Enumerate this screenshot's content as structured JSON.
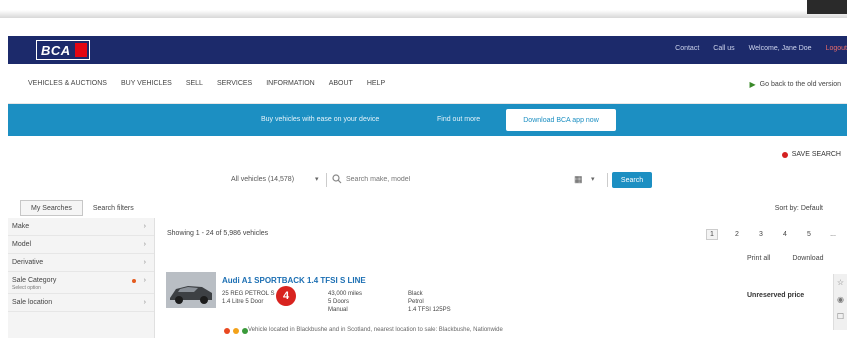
{
  "colors": {
    "header_bg": "#1c2a6b",
    "promo_bg": "#1c8fc2",
    "accent_red": "#d8231f",
    "link_blue": "#1c6fb3"
  },
  "header": {
    "logo_text": "BCA",
    "links": [
      "Contact",
      "Call us",
      "Welcome, Jane Doe",
      "Logout"
    ]
  },
  "nav": {
    "items": [
      "VEHICLES & AUCTIONS",
      "BUY VEHICLES",
      "SELL",
      "SERVICES",
      "INFORMATION",
      "ABOUT",
      "HELP"
    ],
    "right_label": "Go back to the old version"
  },
  "promo": {
    "text1": "Buy vehicles with ease on your device",
    "text2": "Find out more",
    "button": "Download BCA app now"
  },
  "saved_search": "SAVE SEARCH",
  "search": {
    "label": "All vehicles (14,578)",
    "placeholder": "Search make, model",
    "button": "Search"
  },
  "tabs": [
    "My Searches",
    "Search filters"
  ],
  "sort_label": "Sort by: Default",
  "sidebar": {
    "filters": [
      {
        "label": "Make",
        "sub": ""
      },
      {
        "label": "Model",
        "sub": ""
      },
      {
        "label": "Derivative",
        "sub": ""
      },
      {
        "label": "Sale Category",
        "sub": "Select option"
      },
      {
        "label": "Sale location",
        "sub": ""
      }
    ]
  },
  "results": {
    "count": "Showing 1 - 24 of 5,986 vehicles",
    "pagination": [
      "1",
      "2",
      "3",
      "4",
      "5",
      "...",
      "›"
    ],
    "actions": [
      "Print all",
      "Download"
    ]
  },
  "vehicle": {
    "title": "Audi A1 SPORTBACK 1.4 TFSI S LINE",
    "specs_col1": [
      "25 REG PETROL S",
      "1.4 Litre 5 Door"
    ],
    "specs_col2": [
      "43,000 miles",
      "5 Doors",
      "Manual"
    ],
    "specs_col3": [
      "Black",
      "Petrol",
      "1.4 TFSI 125PS"
    ],
    "price": "Unreserved price",
    "flags_text": "Vehicle located in Blackbushe and in Scotland, nearest location to sale: Blackbushe, Nationwide"
  },
  "step_badge": "4"
}
